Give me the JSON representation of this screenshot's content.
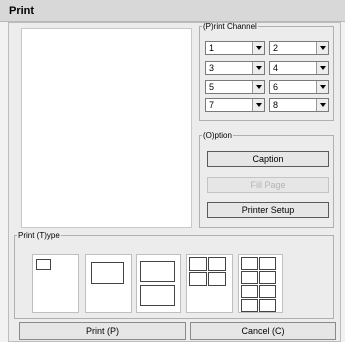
{
  "window": {
    "title": "Print"
  },
  "channel": {
    "legend": "(P)rint Channel",
    "selects": [
      {
        "value": "1"
      },
      {
        "value": "2"
      },
      {
        "value": "3"
      },
      {
        "value": "4"
      },
      {
        "value": "5"
      },
      {
        "value": "6"
      },
      {
        "value": "7"
      },
      {
        "value": "8"
      }
    ]
  },
  "option": {
    "legend": "(O)ption",
    "caption": "Caption",
    "fill_page": "Fill Page",
    "printer_setup": "Printer Setup"
  },
  "type": {
    "legend": "Print (T)ype",
    "layouts": [
      {
        "name": "1-small"
      },
      {
        "name": "1-full"
      },
      {
        "name": "2"
      },
      {
        "name": "4"
      },
      {
        "name": "8"
      }
    ]
  },
  "actions": {
    "print": "Print (P)",
    "cancel": "Cancel (C)"
  }
}
